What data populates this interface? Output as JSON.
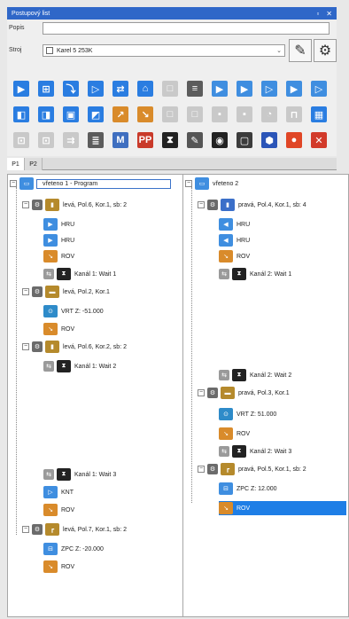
{
  "window": {
    "title": "Postupový list",
    "pin_icon": "pin-icon",
    "close_icon": "close-icon"
  },
  "props": {
    "popis_label": "Popis",
    "popis_value": "",
    "stroj_label": "Stroj",
    "stroj_value": "Karel 5 253K",
    "edit_icon": "edit-icon",
    "settings_icon": "gear-icon"
  },
  "tabs": [
    {
      "label": "P1",
      "active": true
    },
    {
      "label": "P2",
      "active": false
    }
  ],
  "left_tree": {
    "root": "vřeteno 1 - Program",
    "rows": [
      {
        "label": "levá, Pol.6, Kor.1, sb: 2"
      },
      {
        "label": "HRU"
      },
      {
        "label": "HRU"
      },
      {
        "label": "ROV"
      },
      {
        "label": "Kanál 1: Wait 1"
      },
      {
        "label": "levá, Pol.2, Kor.1"
      },
      {
        "label": "VRT Z: -51.000"
      },
      {
        "label": "ROV"
      },
      {
        "label": "levá, Pol.6, Kor.2, sb: 2"
      },
      {
        "label": "Kanál 1: Wait 2"
      },
      {
        "label": "Kanál 1: Wait 3"
      },
      {
        "label": "KNT"
      },
      {
        "label": "ROV"
      },
      {
        "label": "levá, Pol.7, Kor.1, sb: 2"
      },
      {
        "label": "ZPC Z: -20.000"
      },
      {
        "label": "ROV"
      }
    ]
  },
  "right_tree": {
    "root": "vřeteno 2",
    "rows": [
      {
        "label": "pravá, Pol.4, Kor.1, sb: 4"
      },
      {
        "label": "HRU"
      },
      {
        "label": "HRU"
      },
      {
        "label": "ROV"
      },
      {
        "label": "Kanál 2: Wait 1"
      },
      {
        "label": "Kanál 2: Wait 2"
      },
      {
        "label": "pravá, Pol.3, Kor.1"
      },
      {
        "label": "VRT Z: 51.000"
      },
      {
        "label": "ROV"
      },
      {
        "label": "Kanál 2: Wait 3"
      },
      {
        "label": "pravá, Pol.5, Kor.1, sb: 2"
      },
      {
        "label": "ZPC Z: 12.000"
      },
      {
        "label": "ROV"
      }
    ]
  },
  "colors": {
    "accent": "#2f67c8",
    "selection": "#1e7ee6",
    "ops_blue": "#3f8ee0",
    "tool_gold": "#b58a2c",
    "stop_red": "#d23a2a"
  }
}
